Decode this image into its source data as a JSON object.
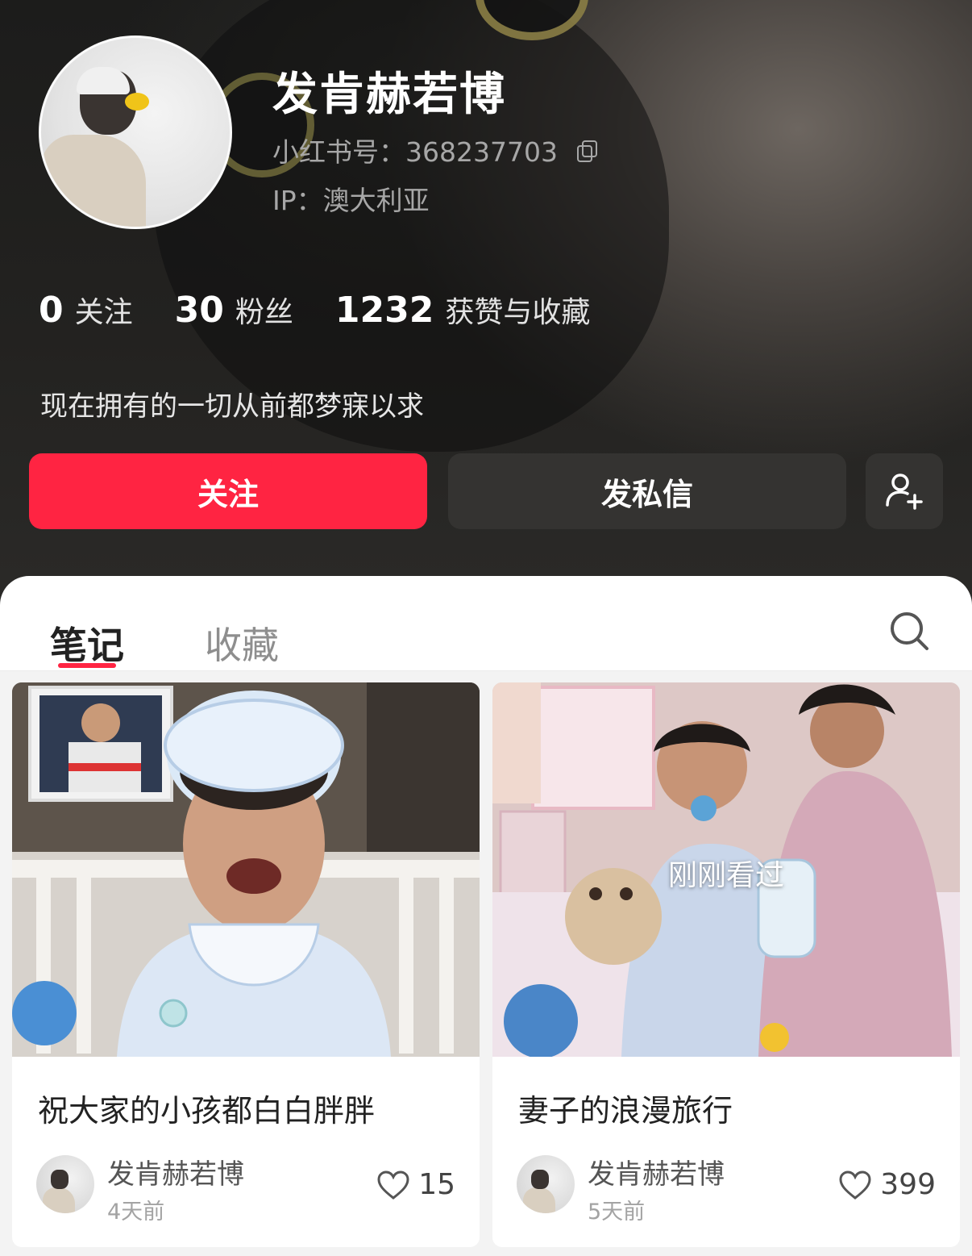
{
  "profile": {
    "name": "发肯赫若博",
    "red_id": "小红书号：368237703",
    "ip": "IP：澳大利亚",
    "bio": "现在拥有的一切从前都梦寐以求",
    "stats": [
      {
        "num": "0",
        "label": "关注"
      },
      {
        "num": "30",
        "label": "粉丝"
      },
      {
        "num": "1232",
        "label": "获赞与收藏"
      }
    ]
  },
  "actions": {
    "follow": "关注",
    "message": "发私信"
  },
  "tabs": {
    "notes": "笔记",
    "favorites": "收藏"
  },
  "notes": [
    {
      "title": "祝大家的小孩都白白胖胖",
      "author": "发肯赫若博",
      "time": "4天前",
      "likes": "15",
      "overlay": ""
    },
    {
      "title": "妻子的浪漫旅行",
      "author": "发肯赫若博",
      "time": "5天前",
      "likes": "399",
      "overlay": "刚刚看过"
    }
  ],
  "colors": {
    "accent": "#ff2442",
    "dark_button": "#343331"
  },
  "icons": [
    "copy-icon",
    "add-user-icon",
    "search-icon",
    "heart-icon"
  ]
}
